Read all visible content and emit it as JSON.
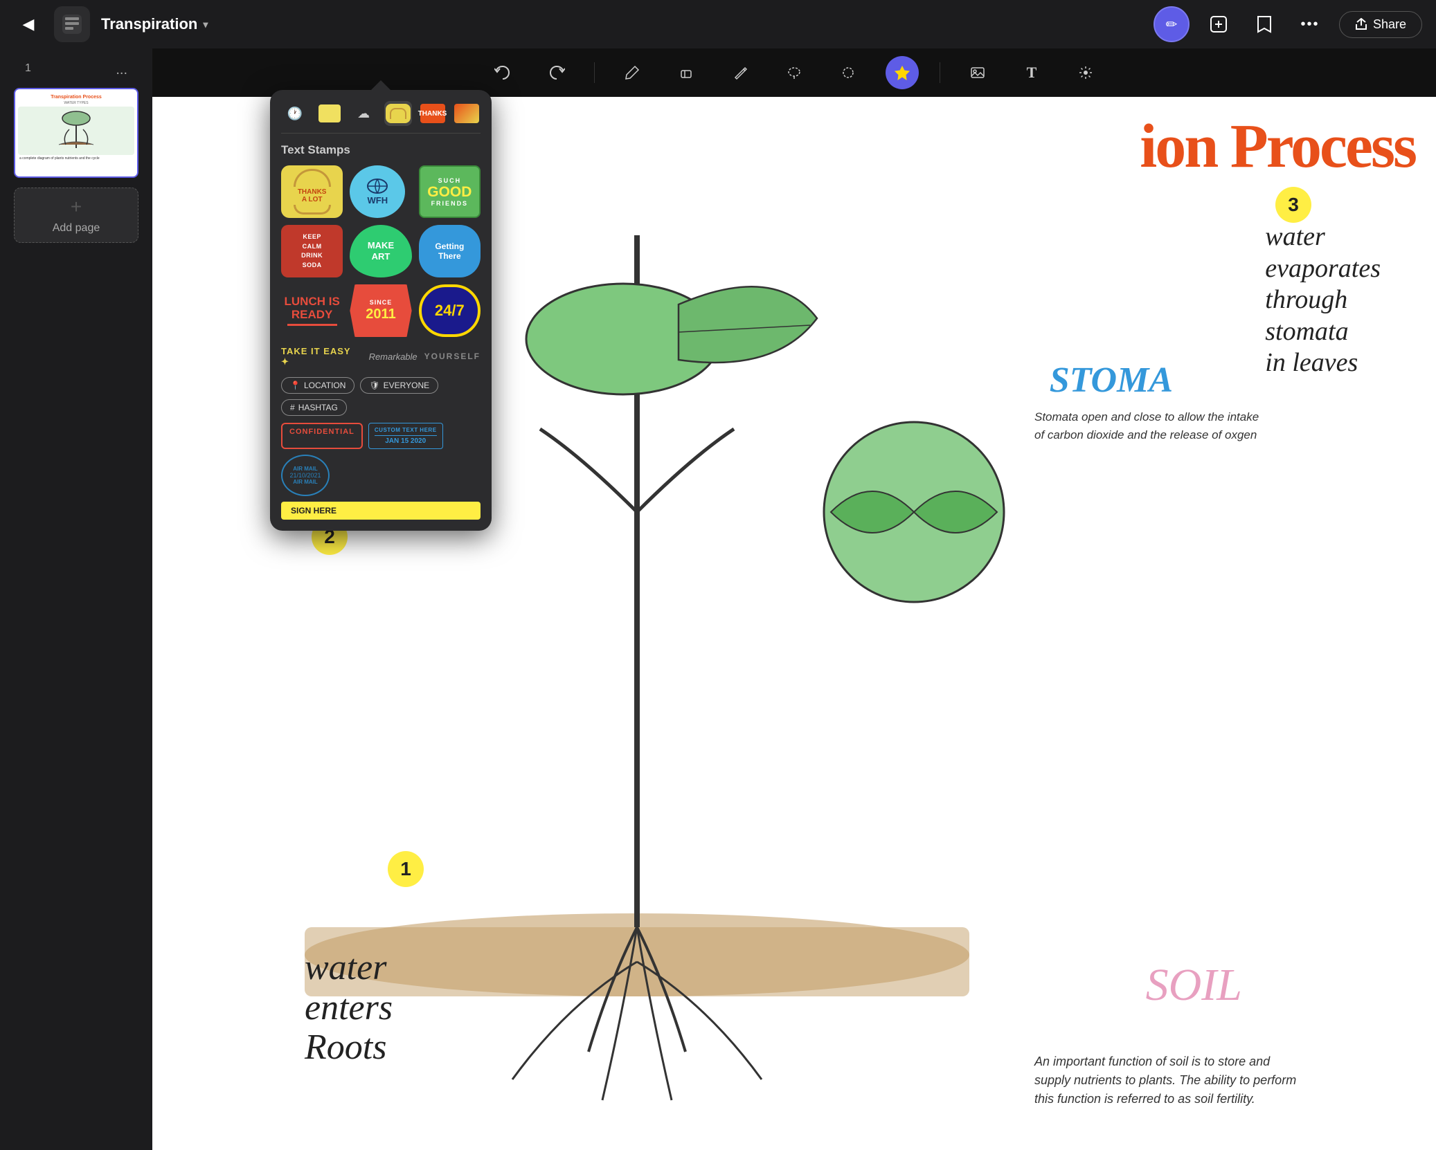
{
  "app": {
    "title": "Transpiration",
    "back_icon": "◀",
    "menu_icon": "☰",
    "profile_icon": "✏",
    "add_page_icon": "🗒",
    "bookmark_icon": "🔖",
    "more_icon": "•••",
    "share_label": "Share"
  },
  "toolbar": {
    "undo_icon": "↩",
    "redo_icon": "↪",
    "pen_icon": "✏",
    "eraser_icon": "⬜",
    "pencil_icon": "✏",
    "lasso_icon": "⬡",
    "shapes_icon": "⬤",
    "sticker_icon": "⭐",
    "image_icon": "🖼",
    "text_icon": "T",
    "magic_icon": "✨"
  },
  "sidebar": {
    "page_number": "1",
    "page_options": "...",
    "add_page_label": "Add page",
    "add_icon": "+"
  },
  "sticker_panel": {
    "title": "Text Stamps",
    "tabs": [
      {
        "id": "recent",
        "icon": "🕐"
      },
      {
        "id": "color",
        "icon": "🟨"
      },
      {
        "id": "cloud",
        "icon": "☁"
      },
      {
        "id": "active1",
        "active": true
      },
      {
        "id": "active2"
      },
      {
        "id": "active3"
      }
    ],
    "stamps": [
      {
        "id": "thanks-a-lot",
        "label": "THANKS A LOT"
      },
      {
        "id": "wfh",
        "label": "WFH"
      },
      {
        "id": "such-good-friends",
        "label": "SUCH GOOD FRIENDS"
      },
      {
        "id": "keep-calm",
        "label": "KEEP CALM DRINK SODA"
      },
      {
        "id": "make-art",
        "label": "MAKE ART"
      },
      {
        "id": "getting-there",
        "label": "Getting There"
      },
      {
        "id": "lunch-is-ready",
        "label": "LUNCH IS READY"
      },
      {
        "id": "since-2011",
        "label": "SINCE 2011"
      },
      {
        "id": "24-7",
        "label": "24/7"
      }
    ],
    "text_stamps": [
      {
        "id": "take-it-easy",
        "label": "TAKE IT EASY"
      },
      {
        "id": "remarkable",
        "label": "Remarkable"
      },
      {
        "id": "yourself",
        "label": "YOURSELF"
      }
    ],
    "badges": [
      {
        "id": "location",
        "label": "LOCATION",
        "icon": "📍"
      },
      {
        "id": "everyone",
        "label": "EVERYONE",
        "icon": "🛡"
      },
      {
        "id": "hashtag",
        "label": "HASHTAG",
        "icon": "#"
      }
    ],
    "document_stamps": [
      {
        "id": "confidential",
        "label": "CONFIDENTIAL"
      },
      {
        "id": "custom-date",
        "label": "CUSTOM TEXT HERE\nJAN 15 2020"
      },
      {
        "id": "air-mail",
        "label": "AIR MAIL\n21/10/2021"
      }
    ],
    "sign_here": "SIGN HERE"
  },
  "canvas": {
    "title": "ion Process",
    "subtitle": "Transpiration Process",
    "water_enters": "water\nenters\nRoots",
    "soil": "SOIL",
    "soil_description": "An important function of soil is to store and supply nutrients to plants. The ability to perform this function is referred to as soil fertility.",
    "stoma": "STOMA",
    "stoma_description": "Stomata open and close to allow the intake of carbon dioxide and the release of oxgen",
    "water_evap": "water\nevaporates\nthrough\nstomata\nin leaves",
    "num_1": "1",
    "num_2": "2",
    "num_3": "3"
  }
}
